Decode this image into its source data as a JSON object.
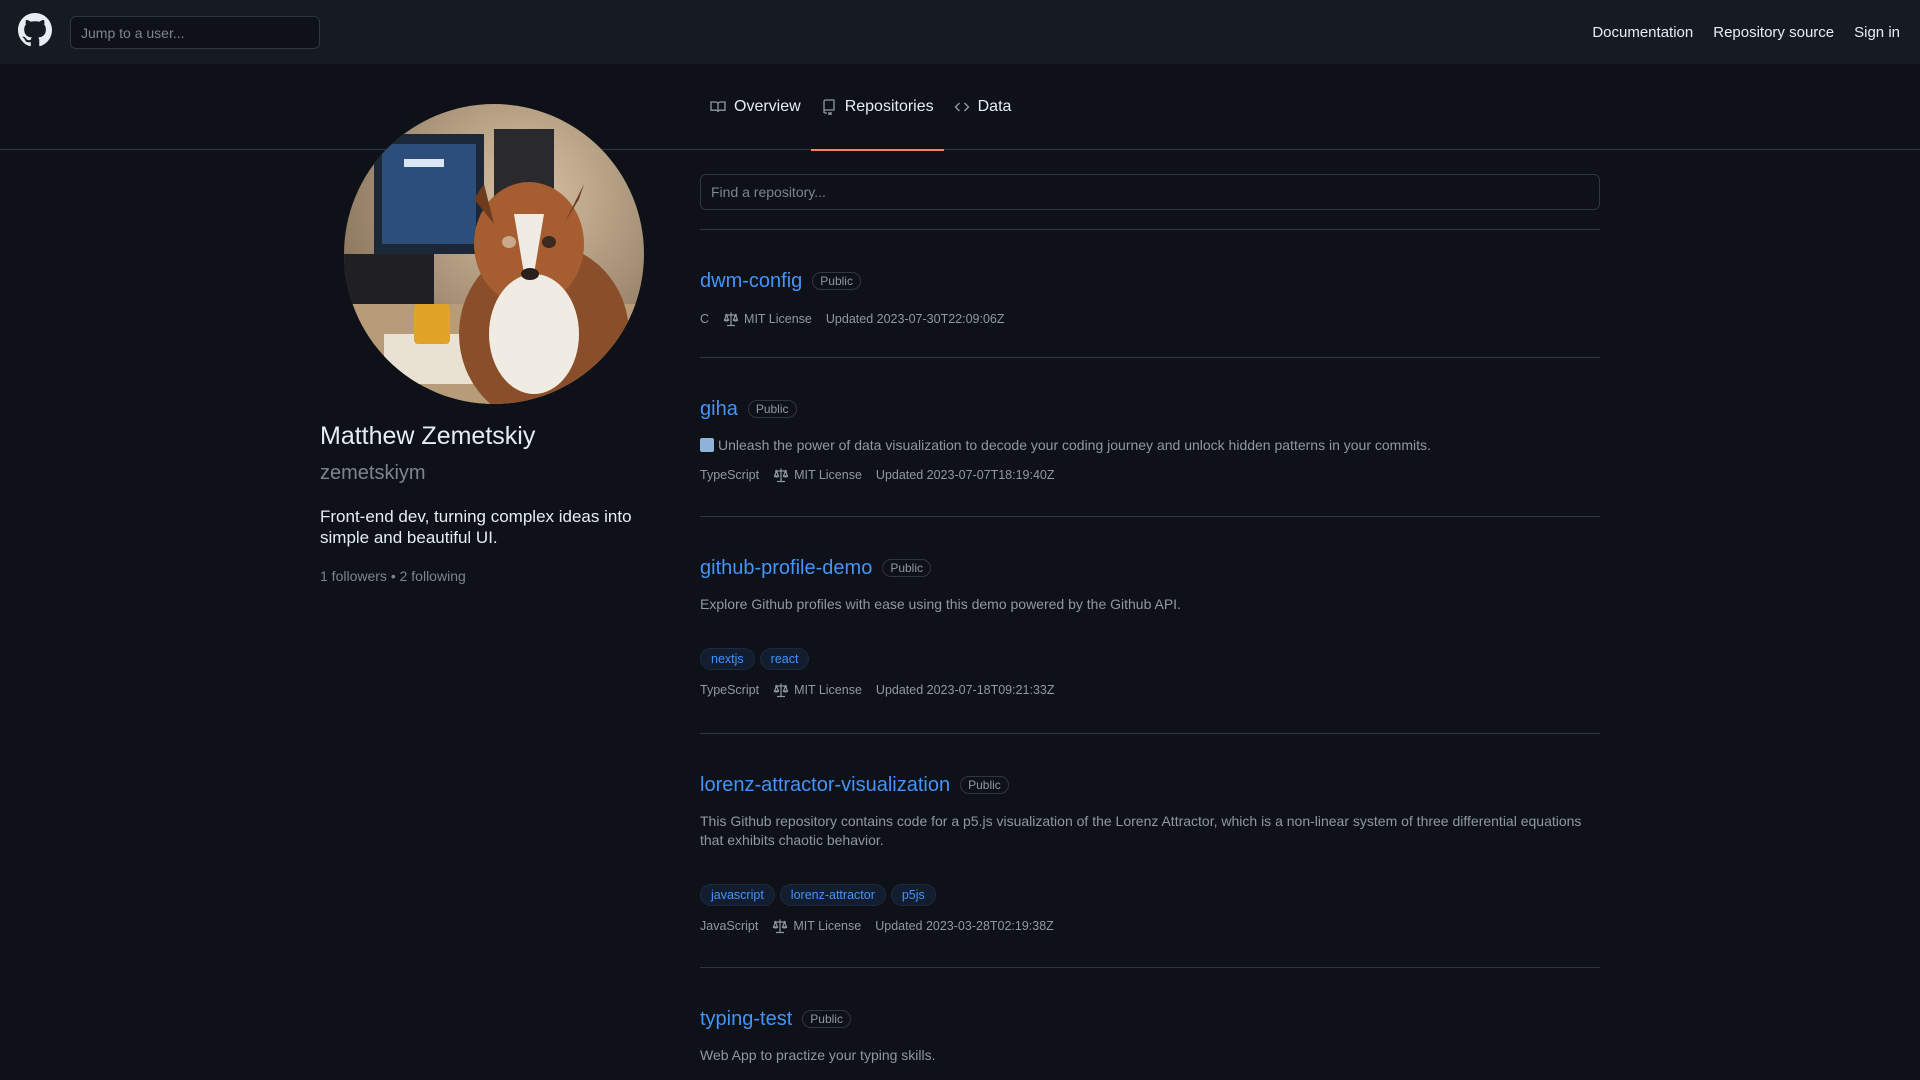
{
  "header": {
    "logo": "github-mark-icon",
    "search_placeholder": "Jump to a user...",
    "nav": [
      "Documentation",
      "Repository source",
      "Sign in"
    ]
  },
  "tabs": [
    {
      "label": "Overview",
      "icon": "book-icon"
    },
    {
      "label": "Repositories",
      "icon": "repo-icon",
      "active": true
    },
    {
      "label": "Data",
      "icon": "code-icon"
    }
  ],
  "profile": {
    "name": "Matthew Zemetskiy",
    "login": "zemetskiym",
    "bio": "Front-end dev, turning complex ideas into simple and beautiful UI.",
    "followers": "1 followers",
    "separator": "•",
    "following": "2 following"
  },
  "repos": {
    "search_placeholder": "Find a repository...",
    "items": [
      {
        "name": "dwm-config",
        "visibility": "Public",
        "description": "",
        "topics": [],
        "language": "C",
        "license": "MIT License",
        "updated": "Updated 2023-07-30T22:09:06Z"
      },
      {
        "name": "giha",
        "visibility": "Public",
        "description": "Unleash the power of data visualization to decode your coding journey and unlock hidden patterns in your commits.",
        "emoji": "bar-chart-emoji",
        "topics": [],
        "language": "TypeScript",
        "license": "MIT License",
        "updated": "Updated 2023-07-07T18:19:40Z"
      },
      {
        "name": "github-profile-demo",
        "visibility": "Public",
        "description": "Explore Github profiles with ease using this demo powered by the Github API.",
        "topics": [
          "nextjs",
          "react"
        ],
        "language": "TypeScript",
        "license": "MIT License",
        "updated": "Updated 2023-07-18T09:21:33Z"
      },
      {
        "name": "lorenz-attractor-visualization",
        "visibility": "Public",
        "description": "This Github repository contains code for a p5.js visualization of the Lorenz Attractor, which is a non-linear system of three differential equations that exhibits chaotic behavior.",
        "topics": [
          "javascript",
          "lorenz-attractor",
          "p5js"
        ],
        "language": "JavaScript",
        "license": "MIT License",
        "updated": "Updated 2023-03-28T02:19:38Z"
      },
      {
        "name": "typing-test",
        "visibility": "Public",
        "description": "Web App to practize your typing skills.",
        "topics": [],
        "language": "",
        "license": "",
        "updated": ""
      }
    ]
  },
  "colors": {
    "background": "#0e1117",
    "header": "#161b22",
    "link": "#4493f8",
    "active_tab_underline": "#f78166",
    "muted": "#9198a1"
  }
}
